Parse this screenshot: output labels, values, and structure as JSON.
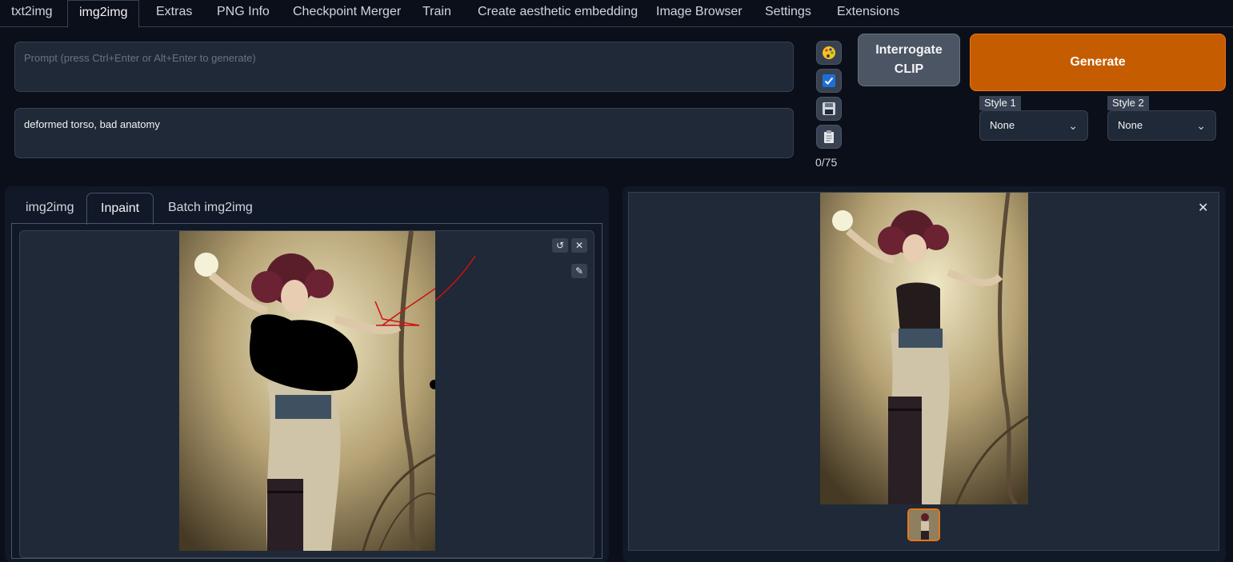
{
  "top_tabs": [
    "txt2img",
    "img2img",
    "Extras",
    "PNG Info",
    "Checkpoint Merger",
    "Train",
    "Create aesthetic embedding",
    "Image Browser",
    "Settings",
    "Extensions"
  ],
  "prompt": {
    "placeholder": "Prompt (press Ctrl+Enter or Alt+Enter to generate)",
    "value": ""
  },
  "negative_prompt": {
    "value": "deformed torso, bad anatomy"
  },
  "tools": {
    "token_counter": "0/75"
  },
  "buttons": {
    "interrogate_line1": "Interrogate",
    "interrogate_line2": "CLIP",
    "generate": "Generate"
  },
  "styles": [
    {
      "label": "Style 1",
      "value": "None"
    },
    {
      "label": "Style 2",
      "value": "None"
    }
  ],
  "sub_tabs": [
    "img2img",
    "Inpaint",
    "Batch img2img"
  ],
  "active_top_tab": "img2img",
  "active_sub_tab": "Inpaint",
  "colors": {
    "accent": "#c65c00",
    "background": "#0b0f19",
    "panel": "#111827"
  }
}
